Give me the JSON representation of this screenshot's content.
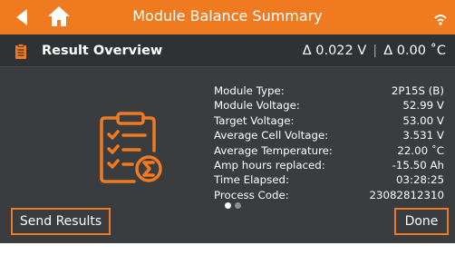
{
  "header": {
    "title": "Module Balance Summary",
    "accent_color": "#f07a20",
    "icons": [
      "back-arrow-icon",
      "home-icon",
      "wifi-icon"
    ]
  },
  "subheader": {
    "title": "Result Overview",
    "delta_voltage": "Δ 0.022 V",
    "separator": "|",
    "delta_temp": "Δ 0.00 ˚C"
  },
  "summary": {
    "rows": [
      {
        "label": "Module Type:",
        "value": "2P15S (B)"
      },
      {
        "label": "Module Voltage:",
        "value": "52.99 V"
      },
      {
        "label": "Target Voltage:",
        "value": "53.00 V"
      },
      {
        "label": "Average Cell Voltage:",
        "value": "3.531 V"
      },
      {
        "label": "Average Temperature:",
        "value": "22.00 ˚C"
      },
      {
        "label": "Amp hours replaced:",
        "value": "-15.50 Ah"
      },
      {
        "label": "Time Elapsed:",
        "value": "03:28:25"
      },
      {
        "label": "Process Code:",
        "value": "23082812310"
      }
    ]
  },
  "pager": {
    "count": 2,
    "active_index": 0
  },
  "footer": {
    "send_label": "Send Results",
    "done_label": "Done"
  }
}
